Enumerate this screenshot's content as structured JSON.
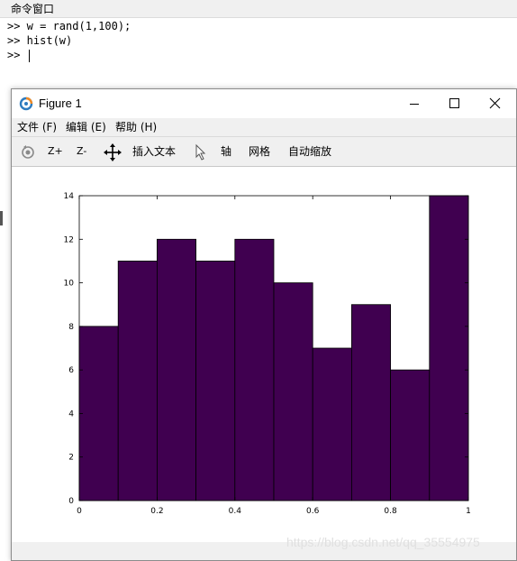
{
  "command_window": {
    "title": "命令窗口",
    "lines": [
      ">> w = rand(1,100);",
      ">> hist(w)",
      ">> "
    ]
  },
  "figure_window": {
    "title": "Figure 1",
    "menu": [
      "文件 (F)",
      "编辑 (E)",
      "帮助 (H)"
    ],
    "toolbar": {
      "zoom_in": "Z+",
      "zoom_out": "Z-",
      "insert_text": "插入文本",
      "axes": "轴",
      "grid": "网格",
      "autoscale": "自动缩放"
    },
    "icons": [
      "octave-logo-icon",
      "minimize-icon",
      "maximize-icon",
      "close-icon",
      "rotate-icon",
      "pan-icon",
      "select-arrow-icon"
    ]
  },
  "chart_data": {
    "type": "bar",
    "title": "",
    "xlabel": "",
    "ylabel": "",
    "bin_edges": [
      0,
      0.1,
      0.2,
      0.3,
      0.4,
      0.5,
      0.6,
      0.7,
      0.8,
      0.9,
      1.0
    ],
    "values": [
      8,
      11,
      12,
      11,
      12,
      10,
      7,
      9,
      6,
      14
    ],
    "xlim": [
      0,
      1
    ],
    "ylim": [
      0,
      14
    ],
    "xticks": [
      "0",
      "0.2",
      "0.4",
      "0.6",
      "0.8",
      "1"
    ],
    "yticks": [
      "0",
      "2",
      "4",
      "6",
      "8",
      "10",
      "12",
      "14"
    ],
    "bar_color": "#400050",
    "grid": false
  },
  "watermark": "https://blog.csdn.net/qq_35554975"
}
